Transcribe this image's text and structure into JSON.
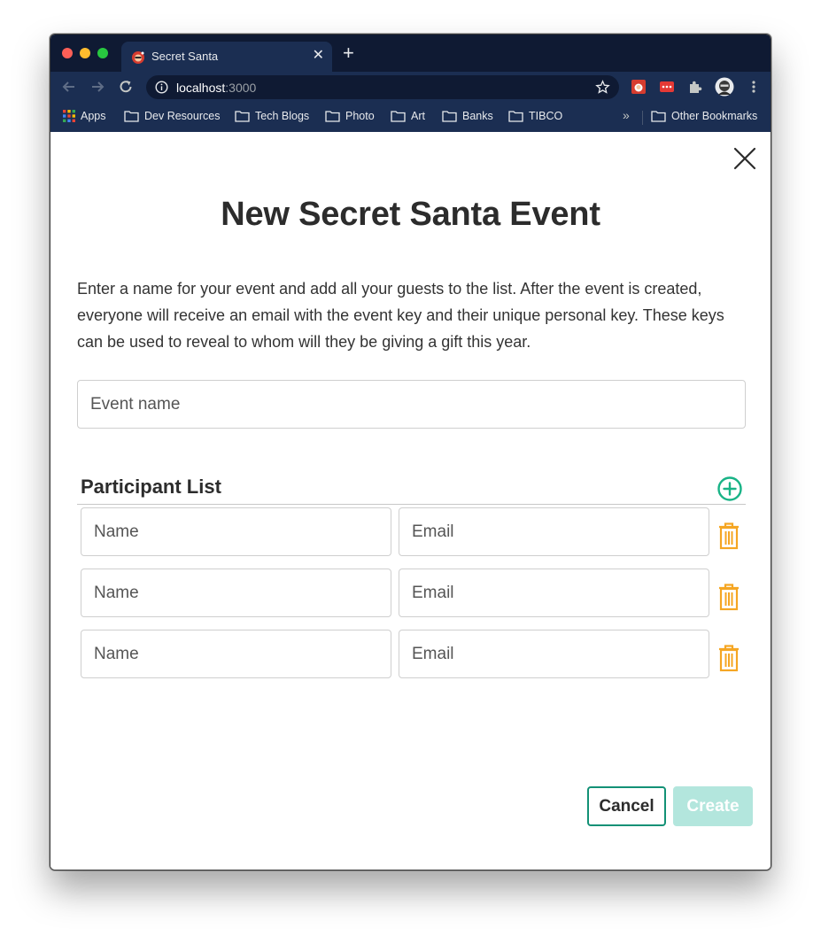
{
  "browser": {
    "tab_title": "Secret Santa",
    "tab_close_glyph": "✕",
    "new_tab_glyph": "+",
    "url_host": "localhost",
    "url_port": ":3000",
    "bookmarks": [
      "Apps",
      "Dev Resources",
      "Tech Blogs",
      "Photo",
      "Art",
      "Banks",
      "TIBCO"
    ],
    "bookmarks_overflow": "»",
    "other_bookmarks": "Other Bookmarks",
    "icons": [
      "back-icon",
      "forward-icon",
      "reload-icon",
      "info-icon",
      "star-icon",
      "extensions-icon",
      "profile-avatar",
      "menu-icon"
    ]
  },
  "page": {
    "title": "New Secret Santa Event",
    "description": "Enter a name for your event and add all your guests to the list. After the event is created, everyone will receive an email with the event key and their unique personal key. These keys can be used to reveal to whom will they be giving a gift this year.",
    "event_name_placeholder": "Event name",
    "participant_list_title": "Participant List",
    "participants": [
      {
        "name_placeholder": "Name",
        "email_placeholder": "Email"
      },
      {
        "name_placeholder": "Name",
        "email_placeholder": "Email"
      },
      {
        "name_placeholder": "Name",
        "email_placeholder": "Email"
      }
    ],
    "cancel_label": "Cancel",
    "create_label": "Create"
  },
  "colors": {
    "accent_green": "#139176",
    "add_icon_green": "#18b386",
    "trash_orange": "#f5a623",
    "create_disabled": "#b3e6dd",
    "chrome_dark": "#0f1a33",
    "chrome_toolbar": "#1b2e52"
  }
}
